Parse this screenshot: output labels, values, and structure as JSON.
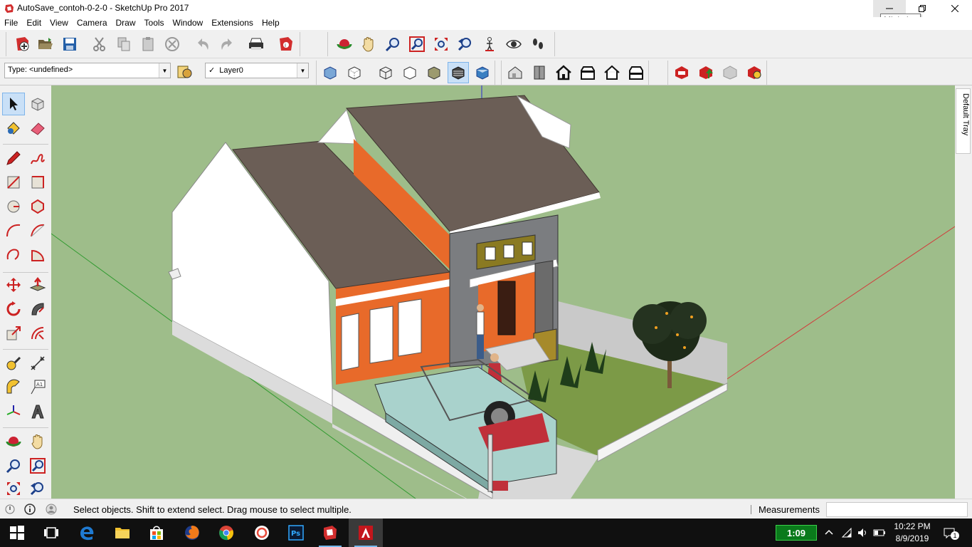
{
  "window": {
    "title": "AutoSave_contoh-0-2-0 - SketchUp Pro 2017",
    "minimize_icon": "minimize-icon",
    "maximize_icon": "restore-icon",
    "close_icon": "close-icon",
    "tooltip": "Minimize"
  },
  "menu": {
    "items": [
      "File",
      "Edit",
      "View",
      "Camera",
      "Draw",
      "Tools",
      "Window",
      "Extensions",
      "Help"
    ]
  },
  "toolbar": {
    "type_combo": "Type: <undefined>",
    "layer_combo": "Layer0",
    "layer_check": "✓"
  },
  "status": {
    "message": "Select objects. Shift to extend select. Drag mouse to select multiple.",
    "measurements_label": "Measurements",
    "measurements_value": ""
  },
  "tray": {
    "label": "Default Tray"
  },
  "taskbar": {
    "battery": "1:09",
    "time": "10:22 PM",
    "date": "8/9/2019",
    "notifications": "1"
  },
  "colors": {
    "sky": "#9ebd8a",
    "axis_red": "#d13b3b",
    "axis_green": "#2f9a2f",
    "axis_blue": "#2b2bd1",
    "roof": "#6b5e56",
    "wall_orange": "#e86a2a",
    "wall_white": "#ffffff",
    "pillar_grey": "#7b7d80"
  }
}
